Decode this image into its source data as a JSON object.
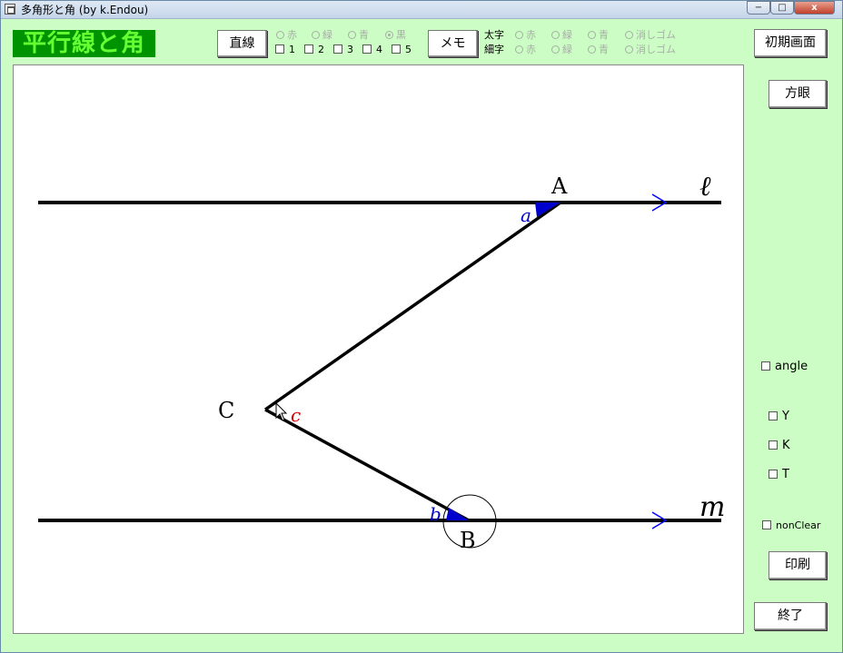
{
  "window": {
    "title": "多角形と角 (by k.Endou)",
    "min": "−",
    "max": "□",
    "close": "x"
  },
  "heading": "平行線と角",
  "buttons": {
    "line": "直線",
    "memo": "メモ",
    "reset": "初期画面",
    "grid": "方眼",
    "print": "印刷",
    "exit": "終了"
  },
  "line_colors": [
    {
      "label": "赤",
      "selected": false
    },
    {
      "label": "緑",
      "selected": false
    },
    {
      "label": "青",
      "selected": false
    },
    {
      "label": "黒",
      "selected": true
    }
  ],
  "line_numbers": [
    "1",
    "2",
    "3",
    "4",
    "5"
  ],
  "pen": {
    "bold_label": "太字",
    "thin_label": "細字",
    "options": [
      "赤",
      "緑",
      "青",
      "消しゴム"
    ]
  },
  "side_checks": {
    "angle": "angle",
    "Y": "Y",
    "K": "K",
    "T": "T",
    "nonclear": "nonClear"
  },
  "diagram": {
    "points": {
      "A": "A",
      "B": "B",
      "C": "C"
    },
    "lines": {
      "l": "ℓ",
      "m": "m"
    },
    "angles": {
      "a": "a",
      "b": "b",
      "c": "c"
    },
    "colors": {
      "angle_fill": "#0000cc",
      "angle_label": "#0000cc",
      "c_label": "#dd0000",
      "arrow": "#0000ff",
      "line": "#000000"
    }
  }
}
